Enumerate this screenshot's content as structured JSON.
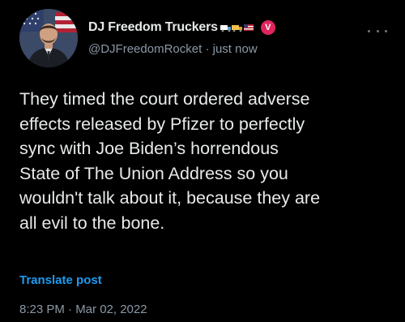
{
  "author": {
    "display_name": "DJ Freedom Truckers",
    "emoji_icons": [
      "truck-icon",
      "truck-icon",
      "flag-icon"
    ],
    "verified_badge": "V",
    "handle": "@DJFreedomRocket",
    "separator": "·",
    "time_ago": "just now"
  },
  "tweet": {
    "text": "They timed the court ordered adverse\neffects released by Pfizer to perfectly\nsync with Joe Biden’s horrendous\nState of The Union Address so you\nwouldn't talk about it, because they are\nall evil to the bone.",
    "translate_label": "Translate post",
    "timestamp": "8:23 PM · Mar 02, 2022"
  },
  "colors": {
    "background": "#000000",
    "text": "#e7e9ea",
    "secondary": "#8b98a5",
    "link": "#1d9bf0",
    "badge": "#e0245e"
  }
}
